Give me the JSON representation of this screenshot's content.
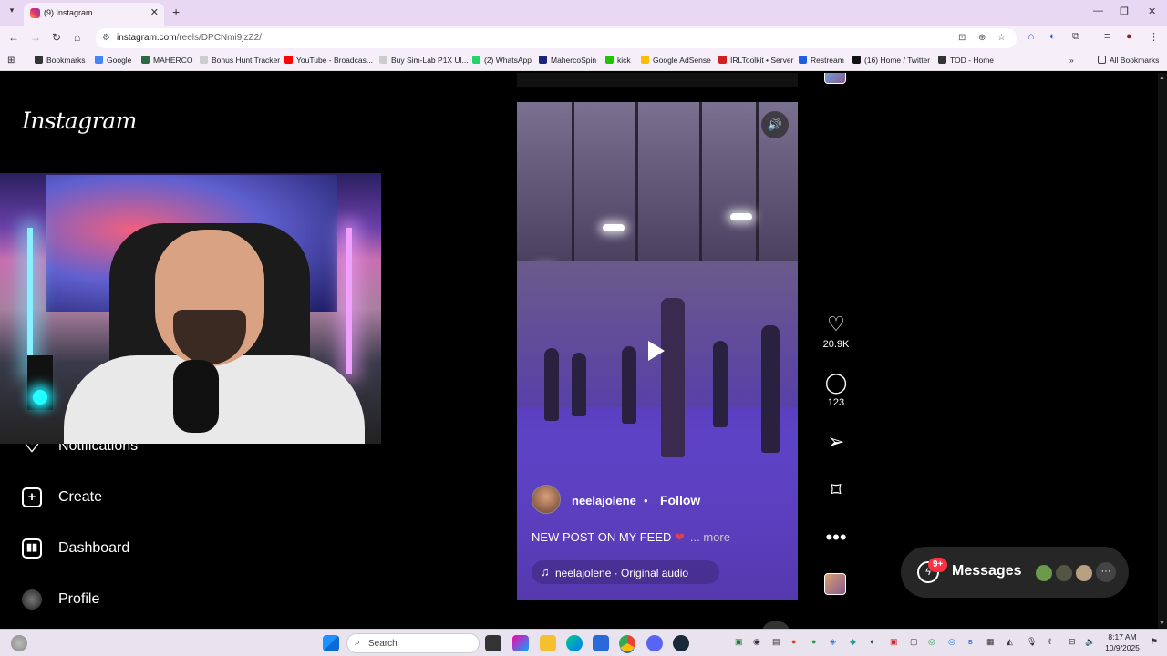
{
  "browser": {
    "tab_title": "(9) Instagram",
    "url_host": "instagram.com",
    "url_path": "/reels/DPCNmi9jzZ2/",
    "bookmarks": [
      {
        "label": "Bookmarks",
        "color": "#333333"
      },
      {
        "label": "Google",
        "color": "#4285f4"
      },
      {
        "label": "MAHERCO",
        "color": "#2a6a40"
      },
      {
        "label": "Bonus Hunt Tracker",
        "color": "#cccccc"
      },
      {
        "label": "YouTube - Broadcas...",
        "color": "#ff0000"
      },
      {
        "label": "Buy Sim-Lab P1X Ul...",
        "color": "#cccccc"
      },
      {
        "label": "(2) WhatsApp",
        "color": "#25d366"
      },
      {
        "label": "MahercoSpin",
        "color": "#1a237e"
      },
      {
        "label": "kick",
        "color": "#1ec400"
      },
      {
        "label": "Google AdSense",
        "color": "#fbbc04"
      },
      {
        "label": "IRLToolkit • Server",
        "color": "#d02020"
      },
      {
        "label": "Restream",
        "color": "#2060e0"
      },
      {
        "label": "(16) Home / Twitter",
        "color": "#111111"
      },
      {
        "label": "TOD - Home",
        "color": "#333333"
      }
    ],
    "all_bookmarks": "All Bookmarks"
  },
  "instagram": {
    "logo": "Instagram",
    "nav": [
      {
        "label": "Notifications",
        "icon": "heart-icon"
      },
      {
        "label": "Create",
        "icon": "plus-square-icon"
      },
      {
        "label": "Dashboard",
        "icon": "bar-chart-icon"
      },
      {
        "label": "Profile",
        "icon": "avatar"
      }
    ],
    "reel": {
      "username": "neelajolene",
      "separator": "•",
      "follow": "Follow",
      "caption": "NEW POST ON MY FEED",
      "caption_more": "... more",
      "audio": "neelajolene · Original audio"
    },
    "actions": {
      "likes": "20.9K",
      "comments": "123"
    },
    "messages": {
      "label": "Messages",
      "badge": "9+"
    }
  },
  "taskbar": {
    "search": "Search",
    "time": "8:17 AM",
    "date": "10/9/2025"
  },
  "colors": {
    "accent": "#ff3040",
    "browser_chrome": "#e9d8f4",
    "taskbar": "#e8e3ef"
  }
}
